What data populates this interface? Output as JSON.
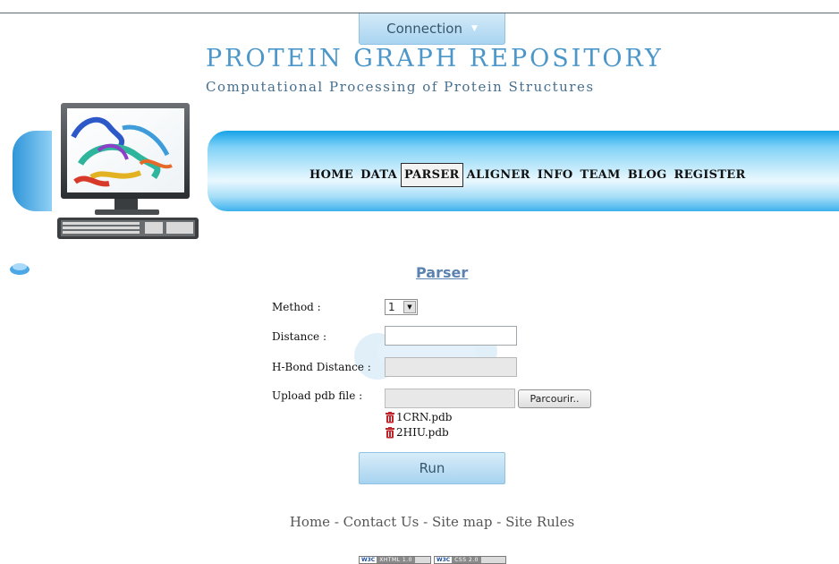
{
  "header": {
    "connection_label": "Connection",
    "title": "PROTEIN GRAPH REPOSITORY",
    "subtitle": "Computational Processing of Protein Structures"
  },
  "nav": {
    "items": [
      {
        "label": "HOME"
      },
      {
        "label": "DATA"
      },
      {
        "label": "PARSER",
        "active": true
      },
      {
        "label": "ALIGNER"
      },
      {
        "label": "INFO"
      },
      {
        "label": "TEAM"
      },
      {
        "label": "BLOG"
      },
      {
        "label": "REGISTER"
      }
    ],
    "active_index": 2
  },
  "form": {
    "heading": "Parser",
    "method_label": "Method :",
    "method_value": "1",
    "distance_label": "Distance :",
    "distance_value": "",
    "hbond_label": "H-Bond Distance :",
    "hbond_value": "",
    "upload_label": "Upload pdb file :",
    "browse_label": "Parcourir..",
    "files": [
      "1CRN.pdb",
      "2HIU.pdb"
    ],
    "run_label": "Run"
  },
  "footer": {
    "links": [
      "Home",
      "Contact Us",
      "Site map",
      "Site Rules"
    ],
    "separator": " - ",
    "badges": [
      {
        "logo": "W3C",
        "text": "XHTML 1.0"
      },
      {
        "logo": "W3C",
        "text": "CSS 2.0"
      }
    ]
  },
  "colors": {
    "title": "#4c97c9",
    "nav_blue": "#16a3e8",
    "button_light": "#d3eaf8",
    "heading_link": "#5b82b0",
    "trash_red": "#c0272d"
  },
  "icons": [
    "chevron-down-icon",
    "cloud-icon",
    "trash-icon",
    "computer-monitor-logo"
  ]
}
